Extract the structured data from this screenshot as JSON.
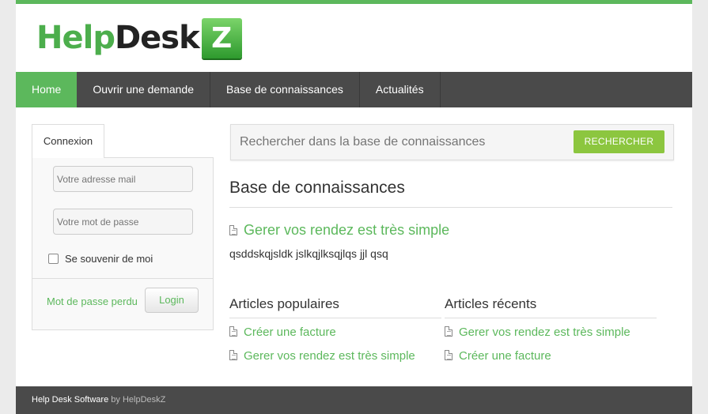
{
  "brand": {
    "help": "Help",
    "desk": "Desk",
    "z": "Z",
    "accent": "#5cb85c"
  },
  "nav": {
    "items": [
      {
        "label": "Home"
      },
      {
        "label": "Ouvrir une demande"
      },
      {
        "label": "Base de connaissances"
      },
      {
        "label": "Actualités"
      }
    ]
  },
  "login": {
    "tab_label": "Connexion",
    "email_placeholder": "Votre adresse mail",
    "password_placeholder": "Votre mot de passe",
    "remember_label": "Se souvenir de moi",
    "lost_password_link": "Mot de passe perdu",
    "login_button": "Login"
  },
  "search": {
    "placeholder": "Rechercher dans la base de connaissances",
    "button_label": "RECHERCHER"
  },
  "kb": {
    "title": "Base de connaissances",
    "featured_title": "Gerer vos rendez est très simple",
    "featured_desc": "qsddskqjsldk jslkqjlksqjlqs jjl qsq"
  },
  "popular": {
    "title": "Articles populaires",
    "items": [
      {
        "label": "Créer une facture"
      },
      {
        "label": "Gerer vos rendez est très simple"
      }
    ]
  },
  "recent": {
    "title": "Articles récents",
    "items": [
      {
        "label": "Gerer vos rendez est très simple"
      },
      {
        "label": "Créer une facture"
      }
    ]
  },
  "footer": {
    "software": "Help Desk Software",
    "by": "by HelpDeskZ"
  }
}
